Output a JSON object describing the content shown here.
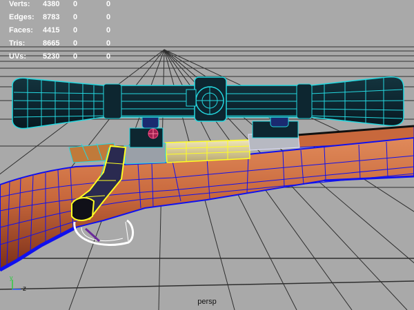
{
  "app": {
    "viewport_camera": "persp"
  },
  "heads_up_display": {
    "rows": [
      {
        "label": "Verts:",
        "total": "4380",
        "selected": "0",
        "component": "0"
      },
      {
        "label": "Edges:",
        "total": "8783",
        "selected": "0",
        "component": "0"
      },
      {
        "label": "Faces:",
        "total": "4415",
        "selected": "0",
        "component": "0"
      },
      {
        "label": "Tris:",
        "total": "8665",
        "selected": "0",
        "component": "0"
      },
      {
        "label": "UVs:",
        "total": "5230",
        "selected": "0",
        "component": "0"
      }
    ]
  },
  "axis_indicator": {
    "y_label": "y",
    "z_label": "z",
    "icon": "view-axis-gizmo-icon"
  },
  "colors": {
    "background": "#a9a9a9",
    "grid": "#2a2a2a",
    "wireframe_blue": "#1010ee",
    "wireframe_cyan": "#24d8e0",
    "selection_yellow": "#ffff22",
    "stock_wood": "#c8683c",
    "scope_body": "#0d2630"
  }
}
